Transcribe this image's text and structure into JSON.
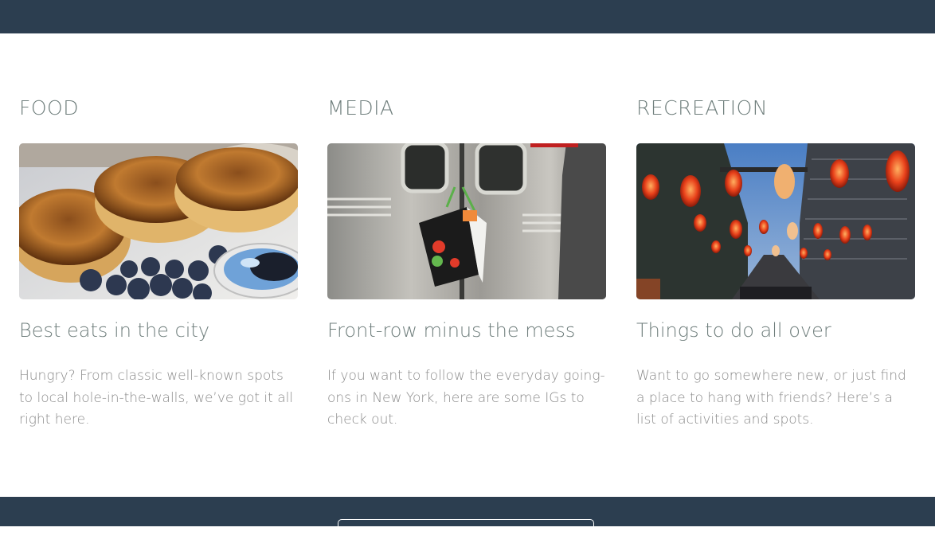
{
  "header": {
    "background": "#2c3e50"
  },
  "cards": [
    {
      "category": "FOOD",
      "title": "Best eats in the city",
      "description": "Hungry? From classic well-known spots to local hole-in-the-walls, we’ve got it all right here.",
      "image": "pancakes-with-blueberries-and-syrup-photo"
    },
    {
      "category": "MEDIA",
      "title": "Front-row minus the mess",
      "description": "If you want to follow the everyday going-ons in New York, here are some IGs to check out.",
      "image": "subway-car-door-with-shopping-bag-photo"
    },
    {
      "category": "RECREATION",
      "title": "Things to do all over",
      "description": "Want to go somewhere new, or just find a place to hang with friends? Here’s a list of activities and spots.",
      "image": "street-with-red-paper-lanterns-photo"
    }
  ],
  "footer": {
    "background": "#2c3e50"
  },
  "colors": {
    "heading": "#6f7e7c",
    "body_text": "#8a8a8a",
    "bar": "#2c3e50"
  }
}
